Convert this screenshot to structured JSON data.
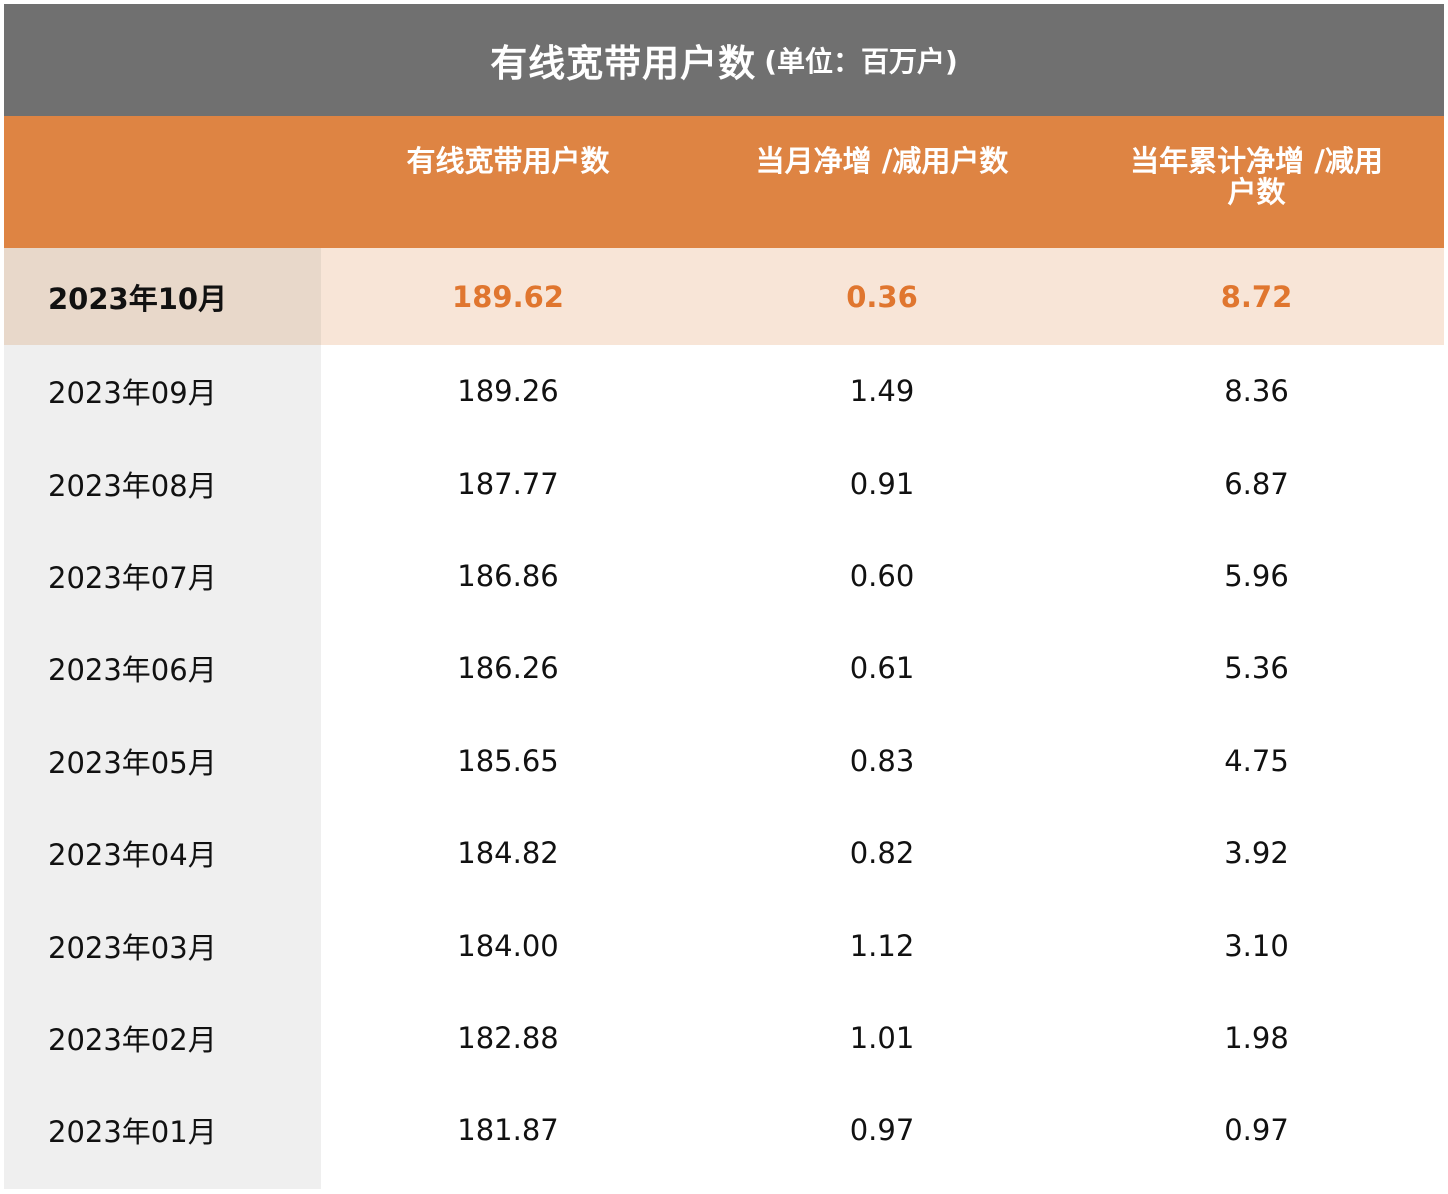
{
  "title": {
    "main": "有线宽带用户数",
    "unit": "(单位：百万户)"
  },
  "header": {
    "col0": "",
    "col1": "有线宽带用户数",
    "col2": "当月净增 /减用户数",
    "col3": "当年累计净增 /减用户数"
  },
  "rows": [
    {
      "month": "2023年10月",
      "users": "189.62",
      "monthly": "0.36",
      "ytd": "8.72"
    },
    {
      "month": "2023年09月",
      "users": "189.26",
      "monthly": "1.49",
      "ytd": "8.36"
    },
    {
      "month": "2023年08月",
      "users": "187.77",
      "monthly": "0.91",
      "ytd": "6.87"
    },
    {
      "month": "2023年07月",
      "users": "186.86",
      "monthly": "0.60",
      "ytd": "5.96"
    },
    {
      "month": "2023年06月",
      "users": "186.26",
      "monthly": "0.61",
      "ytd": "5.36"
    },
    {
      "month": "2023年05月",
      "users": "185.65",
      "monthly": "0.83",
      "ytd": "4.75"
    },
    {
      "month": "2023年04月",
      "users": "184.82",
      "monthly": "0.82",
      "ytd": "3.92"
    },
    {
      "month": "2023年03月",
      "users": "184.00",
      "monthly": "1.12",
      "ytd": "3.10"
    },
    {
      "month": "2023年02月",
      "users": "182.88",
      "monthly": "1.01",
      "ytd": "1.98"
    },
    {
      "month": "2023年01月",
      "users": "181.87",
      "monthly": "0.97",
      "ytd": "0.97"
    }
  ],
  "colors": {
    "title_bg": "#707070",
    "header_bg": "#de8443",
    "highlight_text": "#e0762f",
    "highlight_row_bg": "#f8e5d7",
    "first_col_bg": "#efefef"
  }
}
